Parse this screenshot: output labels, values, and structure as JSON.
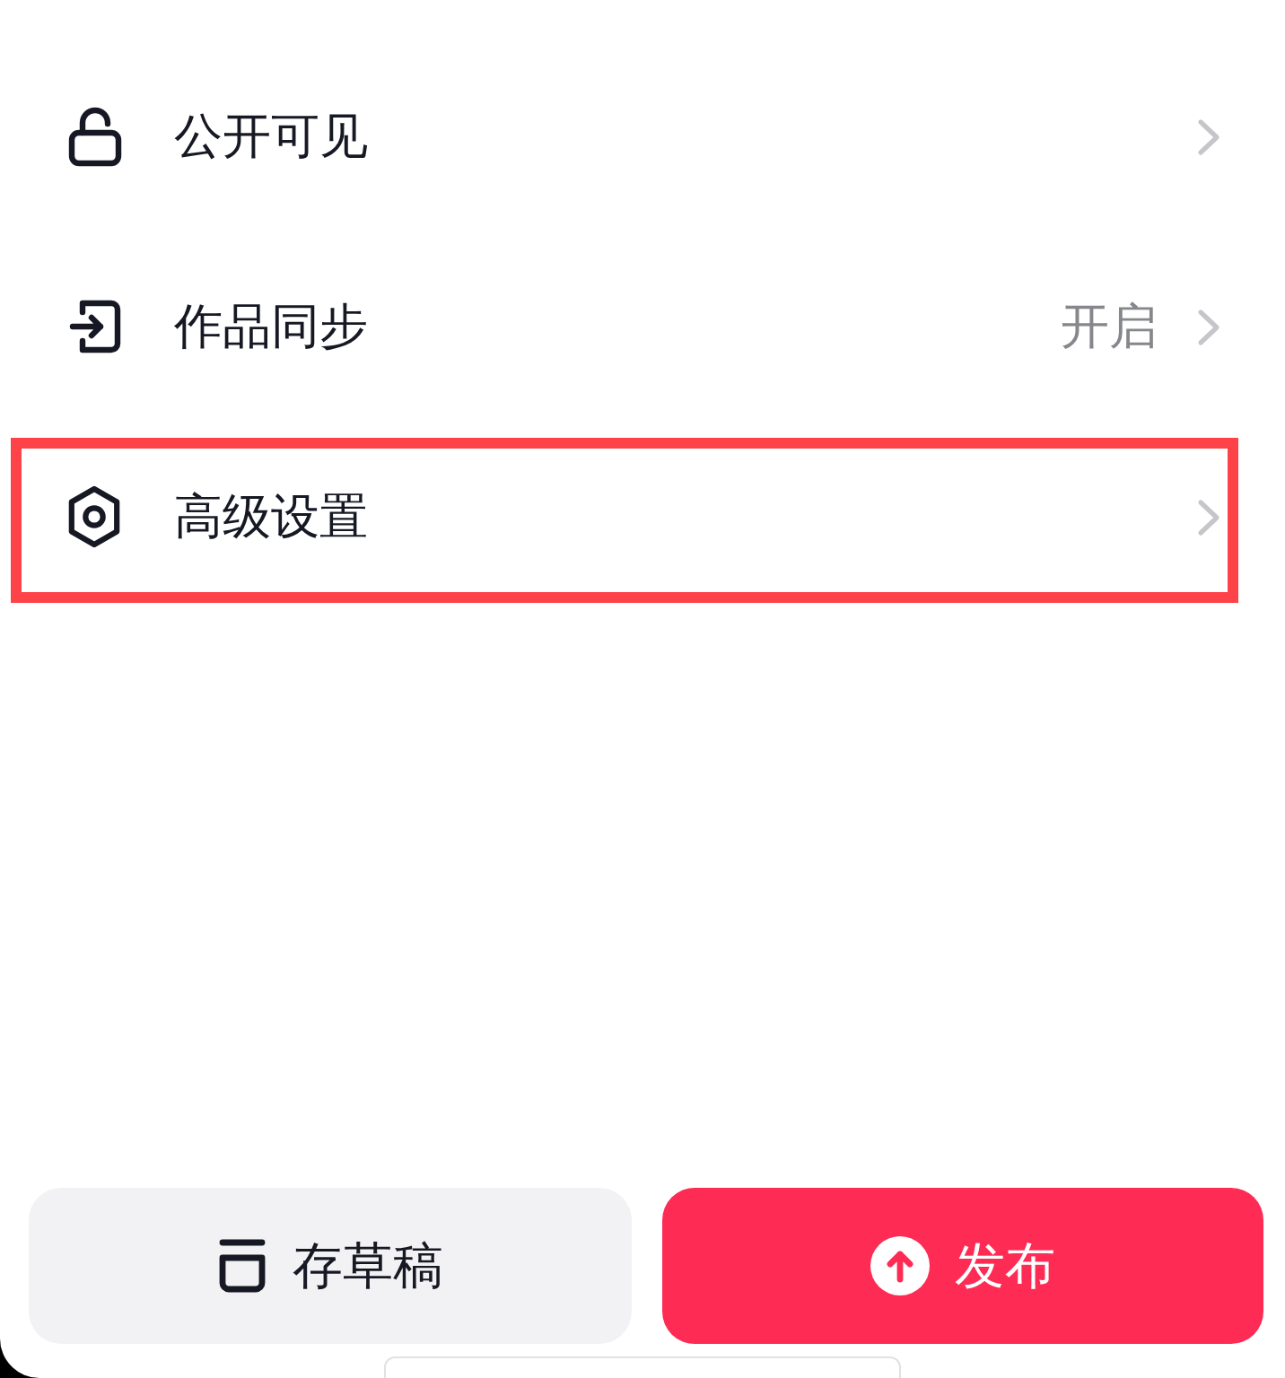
{
  "settings": [
    {
      "label": "公开可见",
      "highlighted": false
    },
    {
      "label": "作品同步",
      "value": "开启",
      "highlighted": false
    },
    {
      "label": "高级设置",
      "highlighted": true
    }
  ],
  "actions": [
    {
      "kind": "secondary",
      "label": "存草稿"
    },
    {
      "kind": "primary",
      "label": "发布"
    }
  ]
}
